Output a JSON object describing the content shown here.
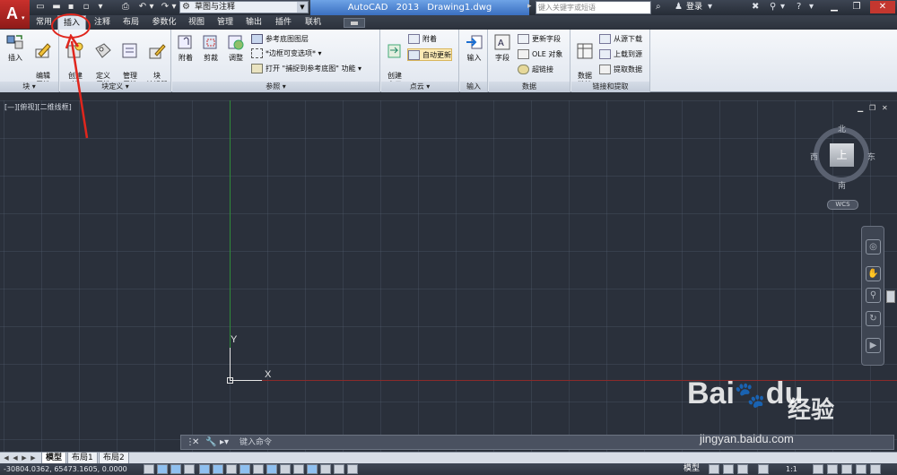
{
  "window": {
    "title": "AutoCAD 2013    Drawing1.dwg",
    "workspace": "草图与注释",
    "search_placeholder": "键入关键字或短语",
    "login": "登录"
  },
  "ribbon_tabs": [
    "常用",
    "插入",
    "注释",
    "布局",
    "参数化",
    "视图",
    "管理",
    "输出",
    "插件",
    "联机"
  ],
  "active_tab": "插入",
  "ribbon": {
    "block": {
      "label": "块",
      "insert": "插入",
      "edit_attr": "编辑\n属性"
    },
    "block_def": {
      "label": "块定义",
      "create": "创建\n块",
      "define_attr": "定义\n属性",
      "manage_attr": "管理\n属性",
      "block_editor": "块\n编辑器"
    },
    "reference": {
      "label": "参照",
      "attach": "附着",
      "clip": "剪裁",
      "adjust": "调整",
      "underlay_layers": "参考底图图层",
      "frame_variable": "*边框可变选项*",
      "open": "打开",
      "snap_ref": "\"捕捉到参考底图\" 功能"
    },
    "point_cloud": {
      "label": "点云",
      "create": "创建\n点云",
      "attach": "附着",
      "auto_update": "自动更新"
    },
    "import": {
      "label": "输入",
      "import": "输入"
    },
    "data": {
      "label": "数据",
      "field": "字段",
      "update_fields": "更新字段",
      "ole": "OLE 对象",
      "hyperlink": "超链接"
    },
    "linking": {
      "label": "链接和提取",
      "data_link": "数据\n链接",
      "download_source": "从源下载",
      "upload_source": "上载到源",
      "extract_data": "提取数据"
    }
  },
  "viewport": {
    "label": "[—][俯视][二维线框]",
    "viewcube": {
      "top": "上",
      "north": "北",
      "south": "南",
      "east": "东",
      "west": "西",
      "wcs": "WCS"
    },
    "ucs": {
      "x": "X",
      "y": "Y"
    }
  },
  "command_line": {
    "placeholder": "键入命令"
  },
  "layout_tabs": [
    "模型",
    "布局1",
    "布局2"
  ],
  "status": {
    "coords": "-30804.0362, 65473.1605, 0.0000",
    "model": "模型",
    "scale": "1:1"
  },
  "watermark": {
    "brand": "Bai",
    "brand2": "du",
    "cn": "经验",
    "url": "jingyan.baidu.com"
  },
  "colors": {
    "accent_red": "#e0261d",
    "title_blue": "#4a82d4",
    "drawing_bg": "#2a303b"
  }
}
